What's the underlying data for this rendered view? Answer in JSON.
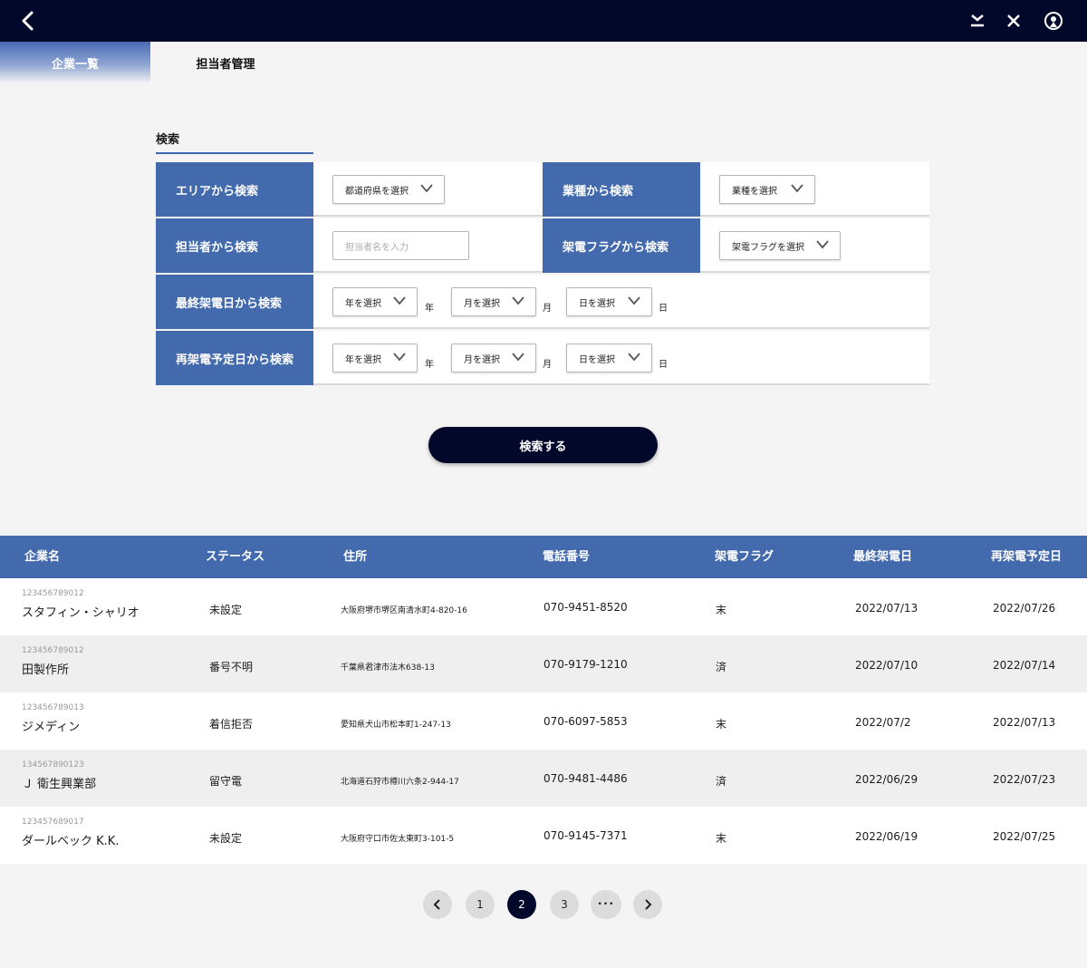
{
  "tabs": [
    {
      "label": "企業一覧",
      "active": true
    },
    {
      "label": "担当者管理",
      "active": false
    }
  ],
  "search": {
    "title": "検索",
    "rows": {
      "area": {
        "label": "エリアから検索",
        "select": "都道府県を選択"
      },
      "industry": {
        "label": "業種から検索",
        "select": "業種を選択"
      },
      "person": {
        "label": "担当者から検索",
        "placeholder": "担当者名を入力"
      },
      "flag": {
        "label": "架電フラグから検索",
        "select": "架電フラグを選択"
      },
      "last_call": {
        "label": "最終架電日から検索"
      },
      "recall": {
        "label": "再架電予定日から検索"
      }
    },
    "date_selects": {
      "year": "年を選択",
      "month": "月を選択",
      "day": "日を選択"
    },
    "date_units": {
      "year": "年",
      "month": "月",
      "day": "日"
    },
    "button": "検索する"
  },
  "table": {
    "headers": [
      "企業名",
      "ステータス",
      "住所",
      "電話番号",
      "架電フラグ",
      "最終架電日",
      "再架電予定日"
    ],
    "rows": [
      {
        "id": "123456789012",
        "name": "スタフィン・シャリオ",
        "status": "未設定",
        "address": "大阪府堺市堺区南清水町4-820-16",
        "phone": "070-9451-8520",
        "flag": "末",
        "last": "2022/07/13",
        "next": "2022/07/26"
      },
      {
        "id": "123456789012",
        "name": "田製作所",
        "status": "番号不明",
        "address": "千葉県君津市法木638-13",
        "phone": "070-9179-1210",
        "flag": "済",
        "last": "2022/07/10",
        "next": "2022/07/14"
      },
      {
        "id": "123456789013",
        "name": "ジメディン",
        "status": "着信拒否",
        "address": "愛知県犬山市松本町1-247-13",
        "phone": "070-6097-5853",
        "flag": "末",
        "last": "2022/07/2",
        "next": "2022/07/13"
      },
      {
        "id": "134567890123",
        "name": "Ｊ 衛生興業部",
        "status": "留守電",
        "address": "北海道石狩市樽川六条2-944-17",
        "phone": "070-9481-4486",
        "flag": "済",
        "last": "2022/06/29",
        "next": "2022/07/23"
      },
      {
        "id": "123457689017",
        "name": "ダールベック K.K.",
        "status": "未設定",
        "address": "大阪府守口市佐太東町3-101-5",
        "phone": "070-9145-7371",
        "flag": "末",
        "last": "2022/06/19",
        "next": "2022/07/25"
      }
    ]
  },
  "pagination": {
    "pages": [
      "1",
      "2",
      "3"
    ],
    "current": "2",
    "ellipsis": "•••"
  }
}
